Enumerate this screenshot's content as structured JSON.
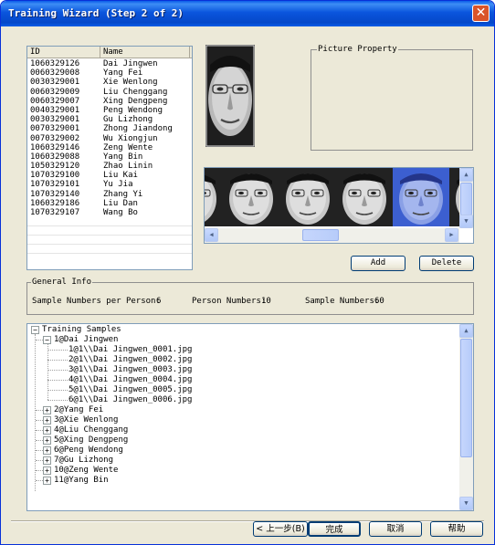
{
  "window": {
    "title": "Training Wizard (Step 2 of 2)",
    "close_label": "✕"
  },
  "table": {
    "columns": [
      "ID",
      "Name"
    ],
    "rows": [
      [
        "1060329126",
        "Dai Jingwen"
      ],
      [
        "0060329008",
        "Yang Fei"
      ],
      [
        "0030329001",
        "Xie Wenlong"
      ],
      [
        "0060329009",
        "Liu Chenggang"
      ],
      [
        "0060329007",
        "Xing Dengpeng"
      ],
      [
        "0040329001",
        "Peng Wendong"
      ],
      [
        "0030329001",
        "Gu Lizhong"
      ],
      [
        "0070329001",
        "Zhong Jiandong"
      ],
      [
        "0070329002",
        "Wu Xiongjun"
      ],
      [
        "1060329146",
        "Zeng Wente"
      ],
      [
        "1060329088",
        "Yang Bin"
      ],
      [
        "1050329120",
        "Zhao Linin"
      ],
      [
        "1070329100",
        "Liu Kai"
      ],
      [
        "1070329101",
        "Yu Jia"
      ],
      [
        "1070329140",
        "Zhang Yi"
      ],
      [
        "1060329186",
        "Liu Dan"
      ],
      [
        "1070329107",
        "Wang Bo"
      ]
    ]
  },
  "picture_property": {
    "label": "Picture Property"
  },
  "buttons": {
    "add": "Add",
    "delete": "Delete"
  },
  "general_info": {
    "label": "General Info",
    "samples_per_person_label": "Sample Numbers per Person:",
    "samples_per_person": "6",
    "person_numbers_label": "Person Numbers:",
    "person_numbers": "10",
    "sample_numbers_label": "Sample Numbers:",
    "sample_numbers": "60"
  },
  "tree": {
    "root": "Training Samples",
    "expanded": "1@Dai Jingwen",
    "children": [
      "1@1\\\\Dai Jingwen_0001.jpg",
      "2@1\\\\Dai Jingwen_0002.jpg",
      "3@1\\\\Dai Jingwen_0003.jpg",
      "4@1\\\\Dai Jingwen_0004.jpg",
      "5@1\\\\Dai Jingwen_0005.jpg",
      "6@1\\\\Dai Jingwen_0006.jpg"
    ],
    "collapsed": [
      "2@Yang Fei",
      "3@Xie Wenlong",
      "4@Liu Chenggang",
      "5@Xing Dengpeng",
      "6@Peng Wendong",
      "7@Gu Lizhong",
      "10@Zeng Wente",
      "11@Yang Bin"
    ]
  },
  "footer": {
    "back": "< 上一步(B)",
    "finish": "完成",
    "cancel": "取消",
    "help": "帮助"
  },
  "colors": {
    "title_bar": "#0a55dd",
    "selected_thumb_tint": "#3c5fd0"
  }
}
